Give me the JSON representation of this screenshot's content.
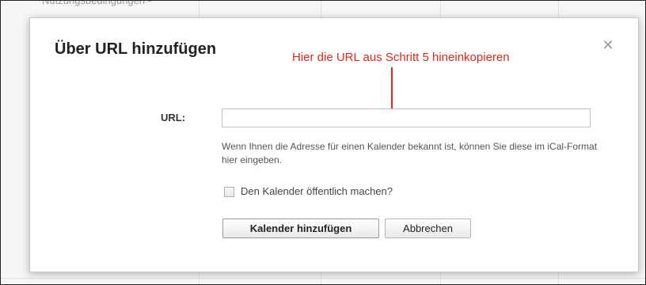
{
  "background": {
    "partial_text": "Nutzungsbedingungen -"
  },
  "dialog": {
    "title": "Über URL hinzufügen",
    "close_icon": "close-icon",
    "annotation": "Hier die URL aus Schritt 5 hineinkopieren",
    "url_label": "URL:",
    "url_value": "",
    "help_text": "Wenn Ihnen die Adresse für einen Kalender bekannt ist, können Sie diese im iCal-Format hier eingeben.",
    "public_checkbox_checked": false,
    "public_label": "Den Kalender öffentlich machen?",
    "add_button": "Kalender hinzufügen",
    "cancel_button": "Abbrechen"
  },
  "colors": {
    "annotation": "#e0261c",
    "input_border": "#b8c4d6"
  }
}
